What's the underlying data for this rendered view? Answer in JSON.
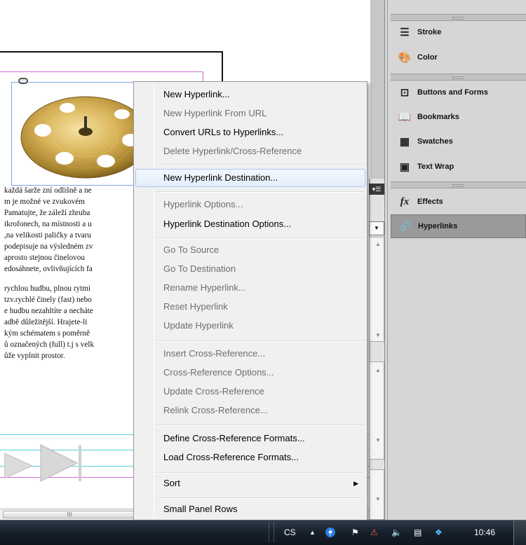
{
  "document": {
    "body_lines": [
      "každá šarže zní odlišně a ne",
      "m je možné ve zvukovém",
      "Pamatujte, že záleží zhruba",
      "ikrofonech, na místnosti a u",
      ",na velikosti paličky a tvaru",
      "podepisuje na výsledném zv",
      "aprosto stejnou činelovou",
      "edosáhnete, ovlivňujících fa",
      "",
      "rychlou hudbu, plnou rytmi",
      "tzv.rychlé činely (fast) nebo",
      "e hudbu nezahltíte a necháte",
      "adbě důležitější. Hrajete-li",
      "kým schématem s poměrně",
      "ů označených (full) t.j s velk",
      "ůže vyplnit prostor."
    ],
    "scroll_thumb_grip": "III"
  },
  "context_menu": {
    "items": [
      {
        "label": "New Hyperlink...",
        "enabled": true
      },
      {
        "label": "New Hyperlink From URL",
        "enabled": false
      },
      {
        "label": "Convert URLs to Hyperlinks...",
        "enabled": true
      },
      {
        "label": "Delete Hyperlink/Cross-Reference",
        "enabled": false
      },
      {
        "separator": true
      },
      {
        "label": "New Hyperlink Destination...",
        "enabled": true,
        "hovered": true
      },
      {
        "separator": true
      },
      {
        "label": "Hyperlink Options...",
        "enabled": false
      },
      {
        "label": "Hyperlink Destination Options...",
        "enabled": true
      },
      {
        "separator": true
      },
      {
        "label": "Go To Source",
        "enabled": false
      },
      {
        "label": "Go To Destination",
        "enabled": false
      },
      {
        "label": "Rename Hyperlink...",
        "enabled": false
      },
      {
        "label": "Reset Hyperlink",
        "enabled": false
      },
      {
        "label": "Update Hyperlink",
        "enabled": false
      },
      {
        "separator": true
      },
      {
        "label": "Insert Cross-Reference...",
        "enabled": false
      },
      {
        "label": "Cross-Reference Options...",
        "enabled": false
      },
      {
        "label": "Update Cross-Reference",
        "enabled": false
      },
      {
        "label": "Relink Cross-Reference...",
        "enabled": false
      },
      {
        "separator": true
      },
      {
        "label": "Define Cross-Reference Formats...",
        "enabled": true
      },
      {
        "label": "Load Cross-Reference Formats...",
        "enabled": true
      },
      {
        "separator": true
      },
      {
        "label": "Sort",
        "enabled": true,
        "submenu": true
      },
      {
        "separator": true
      },
      {
        "label": "Small Panel Rows",
        "enabled": true
      }
    ]
  },
  "panels": {
    "items": [
      {
        "label": "Stroke",
        "icon": "stroke-icon",
        "glyph": "☰"
      },
      {
        "label": "Color",
        "icon": "color-palette-icon",
        "glyph": "🎨"
      },
      {
        "label": "Buttons and Forms",
        "icon": "buttons-forms-icon",
        "glyph": "⊡"
      },
      {
        "label": "Bookmarks",
        "icon": "bookmarks-icon",
        "glyph": "📖"
      },
      {
        "label": "Swatches",
        "icon": "swatches-icon",
        "glyph": "▦"
      },
      {
        "label": "Text Wrap",
        "icon": "text-wrap-icon",
        "glyph": "▣"
      },
      {
        "label": "Effects",
        "icon": "effects-icon",
        "glyph": "fx"
      },
      {
        "label": "Hyperlinks",
        "icon": "hyperlinks-icon",
        "glyph": "🔗",
        "active": true
      }
    ]
  },
  "taskbar": {
    "language": "CS",
    "clock": "10:46"
  },
  "colors": {
    "menu_hover_border": "#a8c8eb",
    "guide_pink": "#d66ad6",
    "guide_cyan": "#52d1e3",
    "panel_active": "#9a9a9a"
  }
}
